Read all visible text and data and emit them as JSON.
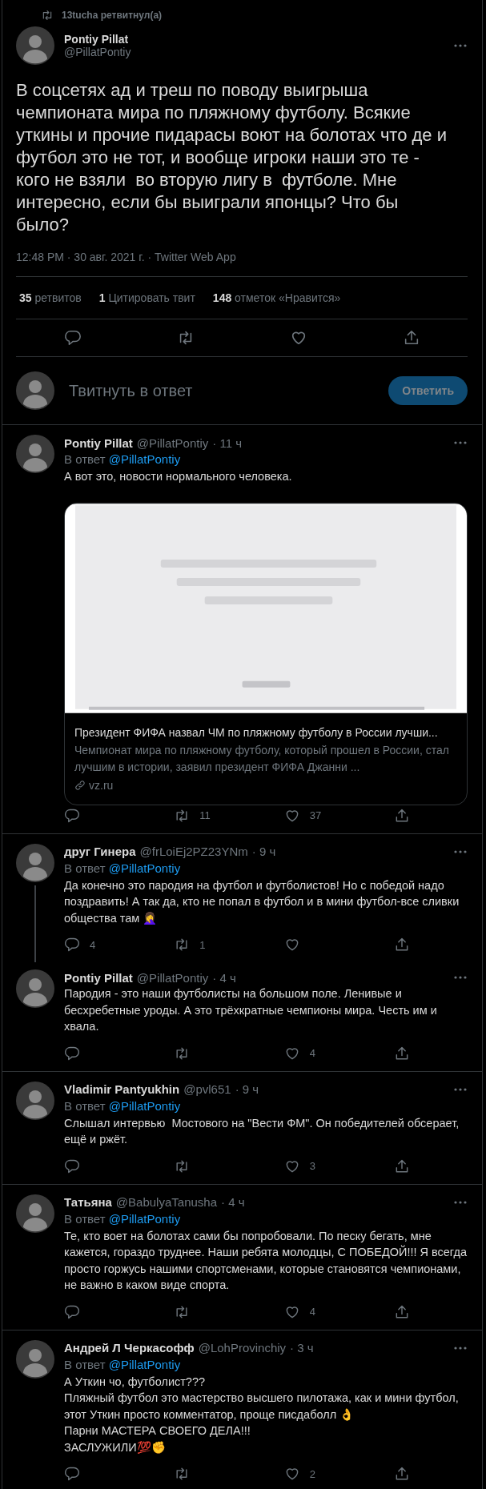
{
  "retweet_banner": {
    "text": "13tucha ретвитнул(а)"
  },
  "main_tweet": {
    "name": "Pontiy Pillat",
    "handle": "@PillatPontiy",
    "text": "В соцсетях ад и треш по поводу выигрыша чемпионата мира по пляжному футболу. Всякие уткины и прочие пидарасы воют на болотах что де и футбол это не тот, и вообще игроки наши это те - кого не взяли  во вторую лигу в  футболе. Мне интересно, если бы выиграли японцы? Что бы было?",
    "meta": "12:48 PM · 30 авг. 2021 г. · Twitter Web App",
    "stats": [
      "**35** ретвитов",
      "**1** Цитировать твит",
      "**148** отметок «Нравится»"
    ],
    "actions": [
      {
        "kind": "reply"
      },
      {
        "kind": "retweet"
      },
      {
        "kind": "like"
      },
      {
        "kind": "share"
      }
    ]
  },
  "reply_box": {
    "placeholder": "Твитнуть в ответ",
    "button": "Ответить"
  },
  "replies": [
    {
      "name": "Pontiy Pillat",
      "handle": "@PillatPontiy",
      "time": "· 11 ч",
      "reply_to_label": "В ответ",
      "reply_to": "@PillatPontiy",
      "text": "А вот это, новости нормального человека.",
      "thread_continues": false,
      "card": {
        "kind": "picture",
        "title": "Президент ФИФА назвал ЧМ по пляжному футболу в России лучши...",
        "description": "Чемпионат мира по пляжному футболу, который прошел в России, стал лучшим в истории, заявил президент ФИФА Джанни ...",
        "domain": "vz.ru"
      },
      "actions": [
        {
          "kind": "reply"
        },
        {
          "kind": "retweet",
          "count": "11"
        },
        {
          "kind": "like",
          "count": "37"
        },
        {
          "kind": "share"
        }
      ]
    },
    {
      "name": "друг Гинера",
      "handle": "@frLoiEj2PZ23YNm",
      "time": "· 9 ч",
      "reply_to_label": "В ответ",
      "reply_to": "@PillatPontiy",
      "text": "Да конечно это пародия на футбол и футболистов! Но с победой надо поздравить! А так да, кто не попал в футбол и в мини футбол-все сливки общества там 🤦‍♀️",
      "thread_continues": true,
      "actions": [
        {
          "kind": "reply",
          "count": "4"
        },
        {
          "kind": "retweet",
          "count": "1"
        },
        {
          "kind": "like"
        },
        {
          "kind": "share"
        }
      ]
    },
    {
      "name": "Pontiy Pillat",
      "handle": "@PillatPontiy",
      "time": "· 4 ч",
      "text": "Пародия - это наши футболисты на большом поле. Ленивые и бесхребетные уроды. А это трёхкратные чемпионы мира. Честь им и хвала.",
      "thread_continues": false,
      "actions": [
        {
          "kind": "reply"
        },
        {
          "kind": "retweet"
        },
        {
          "kind": "like",
          "count": "4"
        },
        {
          "kind": "share"
        }
      ]
    },
    {
      "name": "Vladimir Pantyukhin",
      "handle": "@pvl651",
      "time": "· 9 ч",
      "reply_to_label": "В ответ",
      "reply_to": "@PillatPontiy",
      "text": "Слышал интервью  Мостового на \"Вести ФМ\". Он победителей обсерает, ещё и ржёт.",
      "thread_continues": false,
      "actions": [
        {
          "kind": "reply"
        },
        {
          "kind": "retweet"
        },
        {
          "kind": "like",
          "count": "3"
        },
        {
          "kind": "share"
        }
      ]
    },
    {
      "name": "Татьяна",
      "handle": "@BabulyaTanusha",
      "time": "· 4 ч",
      "reply_to_label": "В ответ",
      "reply_to": "@PillatPontiy",
      "text": "Те, кто воет на болотах сами бы попробовали. По песку бегать, мне кажется, гораздо труднее. Наши ребята молодцы, С ПОБЕДОЙ!!! Я всегда просто горжусь нашими спортсменами, которые становятся чемпионами, не важно в каком виде спорта.",
      "thread_continues": false,
      "actions": [
        {
          "kind": "reply"
        },
        {
          "kind": "retweet"
        },
        {
          "kind": "like",
          "count": "4"
        },
        {
          "kind": "share"
        }
      ]
    },
    {
      "name": "Андрей Л Черкасофф",
      "handle": "@LohProvinchiy",
      "time": "· 3 ч",
      "reply_to_label": "В ответ",
      "reply_to": "@PillatPontiy",
      "text": "А Уткин чо, футболист???\nПляжный футбол это мастерство высшего пилотажа, как и мини футбол, этот Уткин просто комментатор, проще писдаболл 👌\nПарни МАСТЕРА СВОЕГО ДЕЛА!!!\nЗАСЛУЖИЛИ💯✊",
      "thread_continues": false,
      "actions": [
        {
          "kind": "reply"
        },
        {
          "kind": "retweet"
        },
        {
          "kind": "like",
          "count": "2"
        },
        {
          "kind": "share"
        }
      ]
    }
  ]
}
